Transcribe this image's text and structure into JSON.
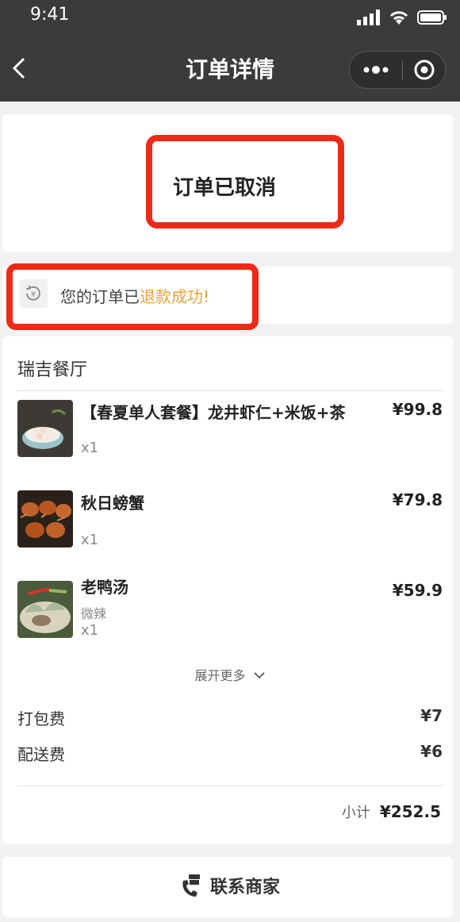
{
  "status_bar": {
    "time": "9:41"
  },
  "nav": {
    "title": "订单详情"
  },
  "order": {
    "status": "订单已取消"
  },
  "refund": {
    "prefix": "您的订单已",
    "highlight": "退款成功!"
  },
  "restaurant": {
    "name": "瑞吉餐厅"
  },
  "items": [
    {
      "name": "【春夏单人套餐】龙井虾仁+米饭+茶",
      "price": "¥99.8",
      "spec": "",
      "qty": "x1",
      "thumb": "shrimp-dish-image"
    },
    {
      "name": "秋日螃蟹",
      "price": "¥79.8",
      "spec": "",
      "qty": "x1",
      "thumb": "crab-dish-image"
    },
    {
      "name": "老鸭汤",
      "price": "¥59.9",
      "spec": "微辣",
      "qty": "x1",
      "thumb": "duck-soup-image"
    }
  ],
  "expand_label": "展开更多",
  "fees": [
    {
      "label": "打包费",
      "value": "¥7"
    },
    {
      "label": "配送费",
      "value": "¥6"
    }
  ],
  "subtotal": {
    "label": "小计",
    "value": "¥252.5"
  },
  "contact_label": "联系商家",
  "colors": {
    "nav_bg": "#3b3b3b",
    "accent": "#f0a038",
    "highlight_border": "#ee2a17"
  }
}
